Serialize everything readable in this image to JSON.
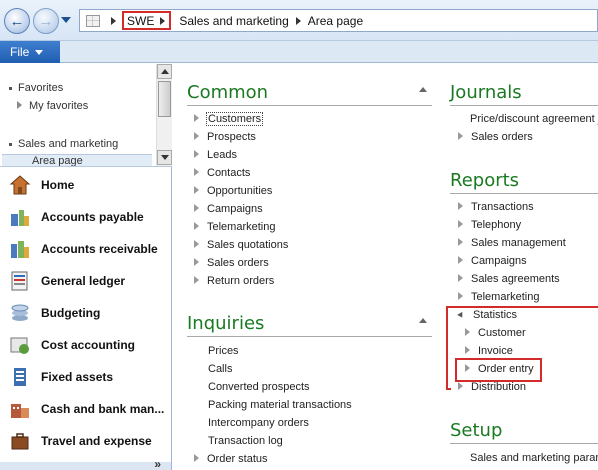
{
  "nav": {
    "breadcrumb": [
      "SWE",
      "Sales and marketing",
      "Area page"
    ]
  },
  "ribbon": {
    "file_label": "File"
  },
  "favorites_pane": {
    "favorites_label": "Favorites",
    "my_favorites_label": "My favorites",
    "sales_marketing_label": "Sales and marketing",
    "area_page_label": "Area page"
  },
  "modules": [
    {
      "label": "Home",
      "icon": "home-icon"
    },
    {
      "label": "Accounts payable",
      "icon": "accounts-payable-icon"
    },
    {
      "label": "Accounts receivable",
      "icon": "accounts-receivable-icon"
    },
    {
      "label": "General ledger",
      "icon": "general-ledger-icon"
    },
    {
      "label": "Budgeting",
      "icon": "budgeting-icon"
    },
    {
      "label": "Cost accounting",
      "icon": "cost-accounting-icon"
    },
    {
      "label": "Fixed assets",
      "icon": "fixed-assets-icon"
    },
    {
      "label": "Cash and bank man...",
      "icon": "cash-bank-icon"
    },
    {
      "label": "Travel and expense",
      "icon": "travel-expense-icon"
    }
  ],
  "common": {
    "title": "Common",
    "items": [
      "Customers",
      "Prospects",
      "Leads",
      "Contacts",
      "Opportunities",
      "Campaigns",
      "Telemarketing",
      "Sales quotations",
      "Sales orders",
      "Return orders"
    ]
  },
  "inquiries": {
    "title": "Inquiries",
    "items": [
      "Prices",
      "Calls",
      "Converted prospects",
      "Packing material transactions",
      "Intercompany orders",
      "Transaction log",
      "Order status"
    ]
  },
  "journals": {
    "title": "Journals",
    "items": [
      "Price/discount agreement j",
      "Sales orders"
    ]
  },
  "reports": {
    "title": "Reports",
    "items": [
      "Transactions",
      "Telephony",
      "Sales management",
      "Campaigns",
      "Sales agreements",
      "Telemarketing"
    ],
    "statistics": {
      "label": "Statistics",
      "children": [
        "Customer",
        "Invoice",
        "Order entry"
      ]
    },
    "after": [
      "Distribution"
    ]
  },
  "setup": {
    "title": "Setup",
    "items": [
      "Sales and marketing param"
    ]
  },
  "colors": {
    "section_title": "#1a7a21",
    "highlight": "#d32a2a",
    "file_button": "#1f5db0"
  }
}
